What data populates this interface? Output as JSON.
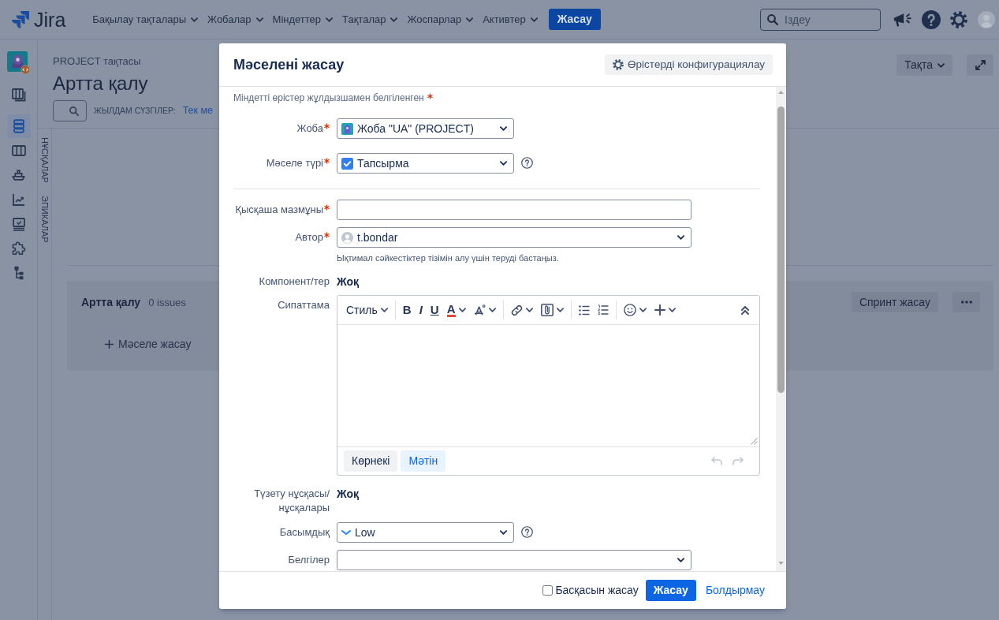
{
  "top_nav": {
    "logo": "Jira",
    "menus": [
      {
        "label": "Бақылау тақталары"
      },
      {
        "label": "Жобалар"
      },
      {
        "label": "Міндеттер"
      },
      {
        "label": "Тақталар"
      },
      {
        "label": "Жоспарлар"
      },
      {
        "label": "Активтер"
      }
    ],
    "create_button": "Жасау",
    "search": {
      "placeholder": "Іздеу"
    }
  },
  "sidebar": {
    "items": [
      {
        "kind": "boards",
        "selected": false
      },
      {
        "kind": "backlog",
        "selected": true
      },
      {
        "kind": "board",
        "selected": false
      },
      {
        "kind": "releases",
        "selected": false
      },
      {
        "kind": "reports",
        "selected": false
      },
      {
        "kind": "tests",
        "selected": false
      },
      {
        "kind": "addons",
        "selected": false
      },
      {
        "kind": "components",
        "selected": false
      }
    ]
  },
  "board": {
    "breadcrumb": "PROJECT тақтасы",
    "title": "Артта қалу",
    "view_button": "Тақта",
    "quick_filters": {
      "label": "ЖЫЛДАМ СҮЗГІЛЕР:",
      "filters": [
        "Тек ме"
      ]
    },
    "side_tabs": [
      "НҰСҚАЛАР",
      "ЭПИКАЛАР"
    ],
    "backlog": {
      "title": "Артта қалу",
      "count": "0 issues",
      "sprint_button": "Спринт жасау",
      "create_issue": "Мәселе жасау"
    }
  },
  "dialog": {
    "title": "Мәселені жасау",
    "configure_button": "Өрістерді конфигурациялау",
    "required_note": "Міндетті өрістер жұлдызшамен белгіленген",
    "sections": [
      {
        "fields": [
          {
            "kind": "project",
            "label": "Жоба",
            "required": true,
            "help": false,
            "value": "Жоба \"UA\" (PROJECT)"
          },
          {
            "kind": "issuetype",
            "label": "Мәселе түрі",
            "required": true,
            "help": true,
            "value": "Тапсырма"
          }
        ]
      },
      {
        "fields": [
          {
            "kind": "text",
            "label": "Қысқаша мазмұны",
            "required": true,
            "help": false
          },
          {
            "kind": "user",
            "label": "Автор",
            "required": true,
            "help": false,
            "value": "t.bondar",
            "hint": "Ықтимал сәйкестіктер тізімін алу үшін теруді бастаңыз."
          },
          {
            "kind": "static",
            "label": "Компонент/тер",
            "required": false,
            "help": false,
            "value": "Жоқ"
          },
          {
            "kind": "editor",
            "label": "Сипаттама",
            "required": false,
            "help": false,
            "toolbar": {
              "groups": [
                {
                  "items": [
                    {
                      "kind": "style",
                      "label": "Стиль",
                      "menu": true
                    }
                  ]
                },
                {
                  "items": [
                    {
                      "kind": "bold",
                      "label": "B",
                      "menu": false
                    },
                    {
                      "kind": "italic",
                      "label": "I",
                      "menu": false
                    },
                    {
                      "kind": "underline",
                      "label": "U",
                      "menu": false
                    },
                    {
                      "kind": "text_color",
                      "label": "A",
                      "menu": true
                    },
                    {
                      "kind": "more_format",
                      "menu": true
                    }
                  ]
                },
                {
                  "items": [
                    {
                      "kind": "link",
                      "menu": true
                    },
                    {
                      "kind": "attachment",
                      "menu": true
                    }
                  ]
                },
                {
                  "items": [
                    {
                      "kind": "bullets",
                      "menu": false
                    },
                    {
                      "kind": "numbering",
                      "menu": false
                    }
                  ]
                },
                {
                  "items": [
                    {
                      "kind": "emoji",
                      "menu": true
                    },
                    {
                      "kind": "insert",
                      "menu": true
                    }
                  ]
                }
              ],
              "end": [
                {
                  "kind": "collapse",
                  "menu": false
                }
              ]
            },
            "modes": [
              {
                "label": "Көрнекі",
                "selected": false
              },
              {
                "label": "Мәтін",
                "selected": true
              }
            ],
            "history": [
              {
                "kind": "undo",
                "disabled": true
              },
              {
                "kind": "redo",
                "disabled": true
              }
            ]
          },
          {
            "kind": "static",
            "label": "Түзету нұсқасы/ нұсқалары",
            "required": false,
            "help": false,
            "value": "Жоқ"
          },
          {
            "kind": "priority",
            "label": "Басымдық",
            "required": false,
            "help": true,
            "value": "Low"
          },
          {
            "kind": "select",
            "label": "Белгілер",
            "required": false,
            "help": false
          }
        ]
      }
    ],
    "footer": {
      "create_another": {
        "label": "Басқасын жасау",
        "checked": false
      },
      "create_button": "Жасау",
      "cancel_link": "Болдырмау"
    }
  }
}
